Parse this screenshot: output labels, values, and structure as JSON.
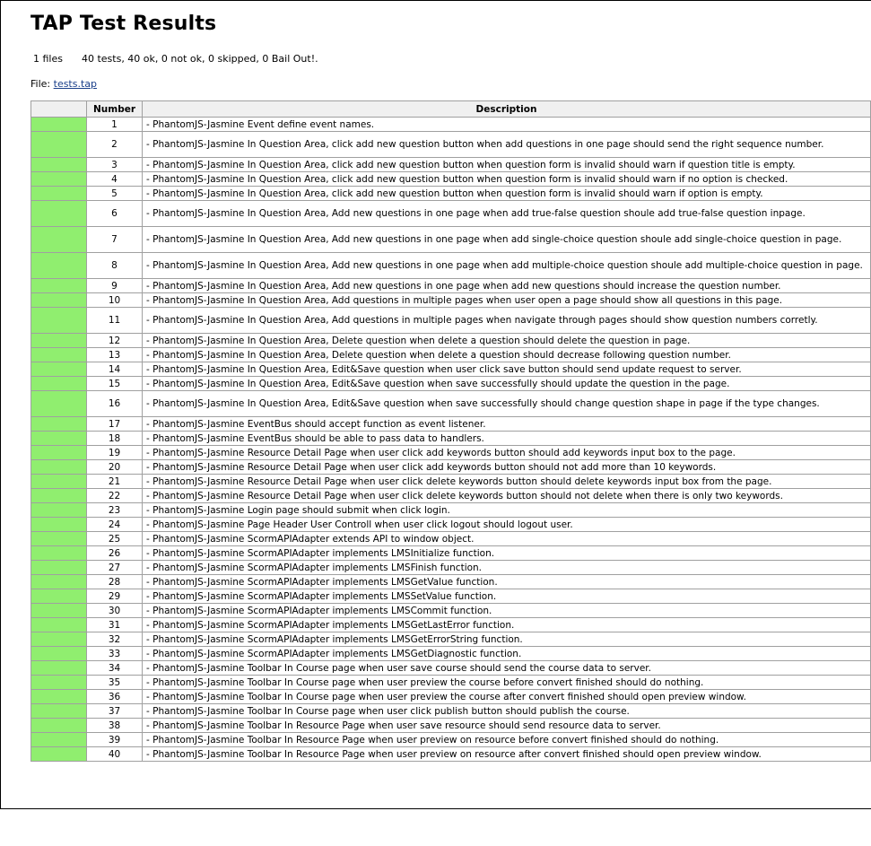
{
  "title": "TAP Test Results",
  "summary": {
    "files": "1 files",
    "stats": "40 tests, 40 ok, 0 not ok, 0 skipped, 0 Bail Out!."
  },
  "file": {
    "label": "File:",
    "link_text": "tests.tap"
  },
  "table": {
    "headers": [
      "",
      "Number",
      "Description"
    ],
    "status_color": "#90ee6f",
    "rows": [
      {
        "number": "1",
        "description": "- PhantomJS-Jasmine Event define event names."
      },
      {
        "number": "2",
        "description": "- PhantomJS-Jasmine In Question Area, click add new question button when add questions in one page should send the right sequence number."
      },
      {
        "number": "3",
        "description": "- PhantomJS-Jasmine In Question Area, click add new question button when question form is invalid should warn if question title is empty."
      },
      {
        "number": "4",
        "description": "- PhantomJS-Jasmine In Question Area, click add new question button when question form is invalid should warn if no option is checked."
      },
      {
        "number": "5",
        "description": "- PhantomJS-Jasmine In Question Area, click add new question button when question form is invalid should warn if option is empty."
      },
      {
        "number": "6",
        "description": "- PhantomJS-Jasmine In Question Area, Add new questions in one page when add true-false question shoule add true-false question inpage."
      },
      {
        "number": "7",
        "description": "- PhantomJS-Jasmine In Question Area, Add new questions in one page when add single-choice question shoule add single-choice question in page."
      },
      {
        "number": "8",
        "description": "- PhantomJS-Jasmine In Question Area, Add new questions in one page when add multiple-choice question shoule add multiple-choice question in page."
      },
      {
        "number": "9",
        "description": "- PhantomJS-Jasmine In Question Area, Add new questions in one page when add new questions should increase the question number."
      },
      {
        "number": "10",
        "description": "- PhantomJS-Jasmine In Question Area, Add questions in multiple pages when user open a page should show all questions in this page."
      },
      {
        "number": "11",
        "description": "- PhantomJS-Jasmine In Question Area, Add questions in multiple pages when navigate through pages should show question numbers corretly."
      },
      {
        "number": "12",
        "description": "- PhantomJS-Jasmine In Question Area, Delete question when delete a question should delete the question in page."
      },
      {
        "number": "13",
        "description": "- PhantomJS-Jasmine In Question Area, Delete question when delete a question should decrease following question number."
      },
      {
        "number": "14",
        "description": "- PhantomJS-Jasmine In Question Area, Edit&Save question when user click save button should send update request to server."
      },
      {
        "number": "15",
        "description": "- PhantomJS-Jasmine In Question Area, Edit&Save question when save successfully should update the question in the page."
      },
      {
        "number": "16",
        "description": "- PhantomJS-Jasmine In Question Area, Edit&Save question when save successfully should change question shape in page if the type changes."
      },
      {
        "number": "17",
        "description": "- PhantomJS-Jasmine EventBus should accept function as event listener."
      },
      {
        "number": "18",
        "description": "- PhantomJS-Jasmine EventBus should be able to pass data to handlers."
      },
      {
        "number": "19",
        "description": "- PhantomJS-Jasmine Resource Detail Page when user click add keywords button should add keywords input box to the page."
      },
      {
        "number": "20",
        "description": "- PhantomJS-Jasmine Resource Detail Page when user click add keywords button should not add more than 10 keywords."
      },
      {
        "number": "21",
        "description": "- PhantomJS-Jasmine Resource Detail Page when user click delete keywords button should delete keywords input box from the page."
      },
      {
        "number": "22",
        "description": "- PhantomJS-Jasmine Resource Detail Page when user click delete keywords button should not delete when there is only two keywords."
      },
      {
        "number": "23",
        "description": "- PhantomJS-Jasmine Login page should submit when click login."
      },
      {
        "number": "24",
        "description": "- PhantomJS-Jasmine Page Header User Controll when user click logout should logout user."
      },
      {
        "number": "25",
        "description": "- PhantomJS-Jasmine ScormAPIAdapter extends API to window object."
      },
      {
        "number": "26",
        "description": "- PhantomJS-Jasmine ScormAPIAdapter implements LMSInitialize function."
      },
      {
        "number": "27",
        "description": "- PhantomJS-Jasmine ScormAPIAdapter implements LMSFinish function."
      },
      {
        "number": "28",
        "description": "- PhantomJS-Jasmine ScormAPIAdapter implements LMSGetValue function."
      },
      {
        "number": "29",
        "description": "- PhantomJS-Jasmine ScormAPIAdapter implements LMSSetValue function."
      },
      {
        "number": "30",
        "description": "- PhantomJS-Jasmine ScormAPIAdapter implements LMSCommit function."
      },
      {
        "number": "31",
        "description": "- PhantomJS-Jasmine ScormAPIAdapter implements LMSGetLastError function."
      },
      {
        "number": "32",
        "description": "- PhantomJS-Jasmine ScormAPIAdapter implements LMSGetErrorString function."
      },
      {
        "number": "33",
        "description": "- PhantomJS-Jasmine ScormAPIAdapter implements LMSGetDiagnostic function."
      },
      {
        "number": "34",
        "description": "- PhantomJS-Jasmine Toolbar In Course page when user save course should send the course data to server."
      },
      {
        "number": "35",
        "description": "- PhantomJS-Jasmine Toolbar In Course page when user preview the course before convert finished should do nothing."
      },
      {
        "number": "36",
        "description": "- PhantomJS-Jasmine Toolbar In Course page when user preview the course after convert finished should open preview window."
      },
      {
        "number": "37",
        "description": "- PhantomJS-Jasmine Toolbar In Course page when user click publish button should publish the course."
      },
      {
        "number": "38",
        "description": "- PhantomJS-Jasmine Toolbar In Resource Page when user save resource should send resource data to server."
      },
      {
        "number": "39",
        "description": "- PhantomJS-Jasmine Toolbar In Resource Page when user preview on resource before convert finished should do nothing."
      },
      {
        "number": "40",
        "description": "- PhantomJS-Jasmine Toolbar In Resource Page when user preview on resource after convert finished should open preview window."
      }
    ]
  }
}
